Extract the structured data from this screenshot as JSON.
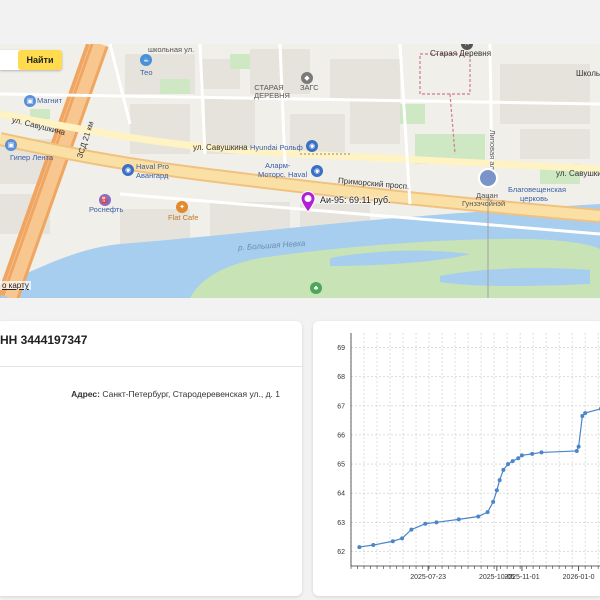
{
  "map": {
    "search_button": "Найти",
    "fuel_price": "Аи-95: 69.11 руб.",
    "open_map_link": "о карту",
    "labels": {
      "school1": "школьная ул.",
      "teo": "Тео",
      "staraya_derevnya_station": "Старая Деревня",
      "school2": "Школь",
      "magnit": "Магнит",
      "saveshkina_left": "ул. Савушкина",
      "zsd": "ЗСД 21 км",
      "staraya_derevnya_area": "СТАРАЯ ДЕРЕВНЯ",
      "zags": "ЗАГС",
      "lipovaya": "Липовая ал.",
      "giper_lenta": "Гипер Лента",
      "saveshkina_mid": "ул. Савушкина",
      "hyundai": "Hyundai Рольф",
      "saveshkina_right": "ул. Савушкин",
      "haval_pro": "Haval Pro",
      "avangard": "Авангард",
      "alarm_motors": "Аларм-",
      "motors_haval": "Моторс. Haval",
      "primorsky": "Приморский просп.",
      "blagoveshchenskaya": "Благовещенская",
      "church": "церковь",
      "datsan": "Дацан",
      "gunzechoinei": "Гунзэчойнэй",
      "rosneft": "Роснефть",
      "flat_cafe": "Flat Cafe",
      "bolshaya_nevka": "р. Большая Невка"
    }
  },
  "station": {
    "inn_title": "НН 3444197347",
    "address_label": "Адрес:",
    "address_value": "Санкт-Петербург, Стародеревенская ул., д. 1"
  },
  "colors": {
    "line": "#4a86c8",
    "search_button": "#ffdb4d",
    "marker": "#b21fd6"
  },
  "chart_data": {
    "type": "line",
    "x": [
      "2025-05-10",
      "2025-05-25",
      "2025-06-15",
      "2025-06-25",
      "2025-07-05",
      "2025-07-20",
      "2025-08-01",
      "2025-08-25",
      "2025-09-15",
      "2025-09-25",
      "2025-10-01",
      "2025-10-05",
      "2025-10-08",
      "2025-10-12",
      "2025-10-17",
      "2025-10-22",
      "2025-10-28",
      "2025-11-01",
      "2025-11-12",
      "2025-11-22",
      "2025-12-30",
      "2026-01-01",
      "2026-01-05",
      "2026-01-08",
      "2026-01-25"
    ],
    "y": [
      62.15,
      62.22,
      62.35,
      62.45,
      62.75,
      62.95,
      63.0,
      63.1,
      63.2,
      63.35,
      63.7,
      64.1,
      64.45,
      64.8,
      65.0,
      65.1,
      65.2,
      65.3,
      65.35,
      65.4,
      65.45,
      65.6,
      66.65,
      66.75,
      66.9
    ],
    "x_ticks": [
      "2025-07-23",
      "2025-10-05",
      "2025-11-01",
      "2026-01-0"
    ],
    "y_ticks": [
      62,
      63,
      64,
      65,
      66,
      67,
      68,
      69
    ],
    "ylim": [
      61.5,
      69.5
    ],
    "grid": true
  }
}
